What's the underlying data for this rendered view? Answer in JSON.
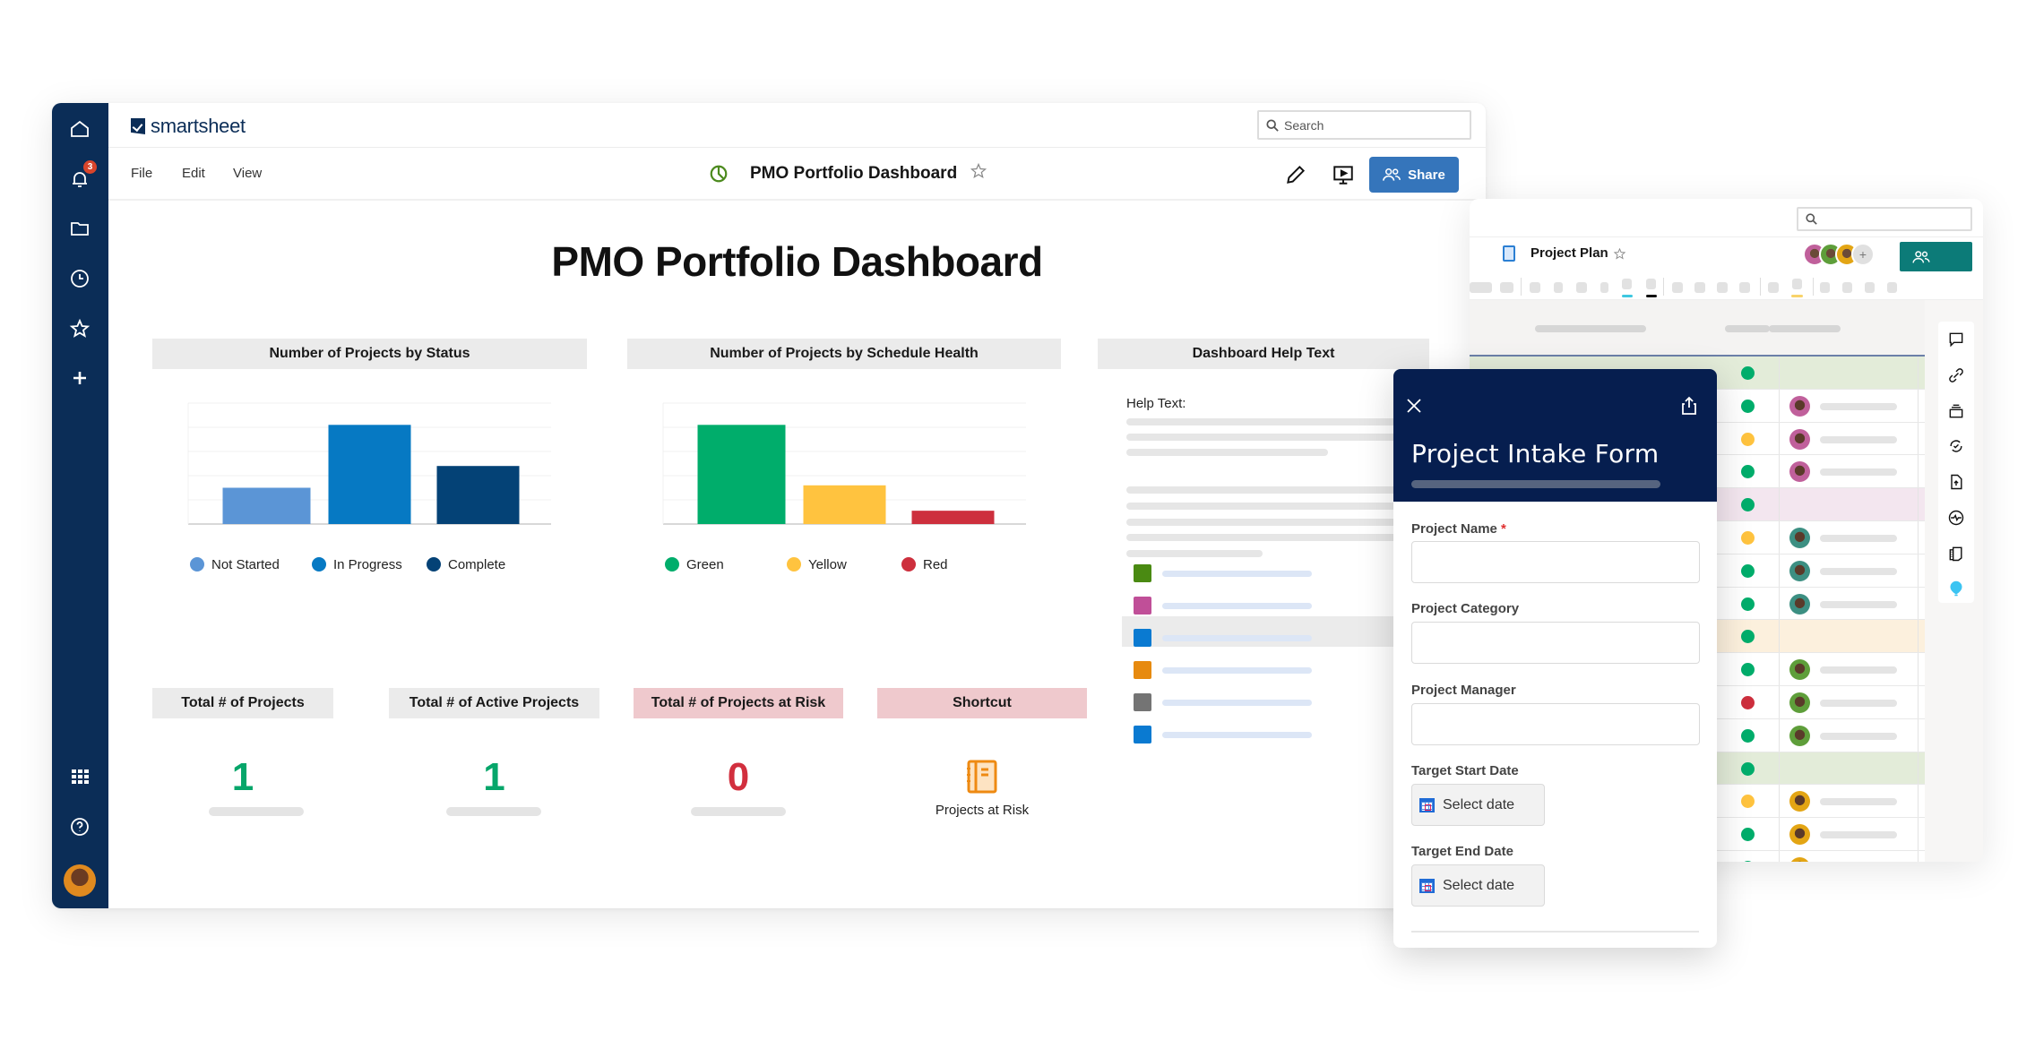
{
  "app": {
    "brand": "smartsheet",
    "search_placeholder": "Search",
    "menu": [
      "File",
      "Edit",
      "View"
    ],
    "document_title": "PMO Portfolio Dashboard",
    "share_label": "Share",
    "notification_count": "3"
  },
  "sidebar": {
    "items": [
      {
        "name": "home",
        "icon": "home-icon"
      },
      {
        "name": "notifications",
        "icon": "bell-icon"
      },
      {
        "name": "browse",
        "icon": "folder-icon"
      },
      {
        "name": "recents",
        "icon": "clock-icon"
      },
      {
        "name": "favorites",
        "icon": "star-icon"
      },
      {
        "name": "create",
        "icon": "plus-icon"
      },
      {
        "name": "launcher",
        "icon": "grid-icon"
      },
      {
        "name": "help",
        "icon": "help-icon"
      },
      {
        "name": "account",
        "icon": "avatar"
      }
    ]
  },
  "dashboard": {
    "title": "PMO Portfolio Dashboard",
    "help_widget": {
      "title": "Dashboard Help Text",
      "label": "Help Text:",
      "legend_colors": [
        "#4a8a12",
        "#c04f98",
        "#0a7ad1",
        "#e78a0f",
        "#747474",
        "#0a7ad1"
      ]
    },
    "metrics": [
      {
        "title": "Total # of Projects",
        "value": "1",
        "color": "#06a66a",
        "tone": "grey"
      },
      {
        "title": "Total # of Active Projects",
        "value": "1",
        "color": "#06a66a",
        "tone": "grey"
      },
      {
        "title": "Total # of Projects at Risk",
        "value": "0",
        "color": "#d22f3e",
        "tone": "pink"
      }
    ],
    "shortcut": {
      "title": "Shortcut",
      "label": "Projects at Risk",
      "icon": "notebook-icon"
    }
  },
  "chart_data": [
    {
      "type": "bar",
      "title": "Number of Projects by Status",
      "categories": [
        "Not Started",
        "In Progress",
        "Complete"
      ],
      "values": [
        1.5,
        4.1,
        2.4
      ],
      "colors": [
        "#5b95d6",
        "#0679c3",
        "#044276"
      ],
      "xlabel": "",
      "ylabel": "",
      "ylim": [
        0,
        5
      ],
      "grid": true,
      "legend": "bottom"
    },
    {
      "type": "bar",
      "title": "Number of Projects by Schedule Health",
      "categories": [
        "Green",
        "Yellow",
        "Red"
      ],
      "values": [
        4.1,
        1.6,
        0.55
      ],
      "colors": [
        "#00ad6b",
        "#ffc33f",
        "#cd2f3d"
      ],
      "xlabel": "",
      "ylabel": "",
      "ylim": [
        0,
        5
      ],
      "grid": true,
      "legend": "bottom"
    }
  ],
  "project_plan": {
    "title": "Project Plan",
    "collaborators": [
      "#c0609b",
      "#5e9e3a",
      "#e3a514"
    ],
    "rows": [
      {
        "band": "#e3ecd9",
        "status": "#00ad6b",
        "owner": null
      },
      {
        "band": "#ffffff",
        "status": "#00ad6b",
        "owner": "#c0609b"
      },
      {
        "band": "#ffffff",
        "status": "#ffc33f",
        "owner": "#c0609b"
      },
      {
        "band": "#ffffff",
        "status": "#00ad6b",
        "owner": "#c0609b"
      },
      {
        "band": "#f3e6ef",
        "status": "#00ad6b",
        "owner": null
      },
      {
        "band": "#ffffff",
        "status": "#ffc33f",
        "owner": "#3c8f82"
      },
      {
        "band": "#ffffff",
        "status": "#00ad6b",
        "owner": "#3c8f82"
      },
      {
        "band": "#ffffff",
        "status": "#00ad6b",
        "owner": "#3c8f82"
      },
      {
        "band": "#fcf0dd",
        "status": "#00ad6b",
        "owner": null
      },
      {
        "band": "#ffffff",
        "status": "#00ad6b",
        "owner": "#5e9e3a"
      },
      {
        "band": "#ffffff",
        "status": "#cd2f3d",
        "owner": "#5e9e3a"
      },
      {
        "band": "#ffffff",
        "status": "#00ad6b",
        "owner": "#5e9e3a"
      },
      {
        "band": "#e3ecd9",
        "status": "#00ad6b",
        "owner": null
      },
      {
        "band": "#ffffff",
        "status": "#ffc33f",
        "owner": "#e3a514"
      },
      {
        "band": "#ffffff",
        "status": "#00ad6b",
        "owner": "#e3a514"
      },
      {
        "band": "#ffffff",
        "status": "#00ad6b",
        "owner": "#e3a514"
      }
    ],
    "rail_icons": [
      "comment-icon",
      "attachment-icon",
      "proofing-icon",
      "update-request-icon",
      "publish-icon",
      "activity-icon",
      "summary-icon",
      "tips-icon"
    ]
  },
  "form": {
    "title": "Project Intake Form",
    "fields": [
      {
        "label": "Project Name",
        "required": true,
        "type": "text",
        "value": ""
      },
      {
        "label": "Project Category",
        "required": false,
        "type": "text",
        "value": ""
      },
      {
        "label": "Project Manager",
        "required": false,
        "type": "text",
        "value": ""
      },
      {
        "label": "Target Start Date",
        "required": false,
        "type": "date",
        "placeholder": "Select date"
      },
      {
        "label": "Target End Date",
        "required": false,
        "type": "date",
        "placeholder": "Select date"
      }
    ]
  }
}
